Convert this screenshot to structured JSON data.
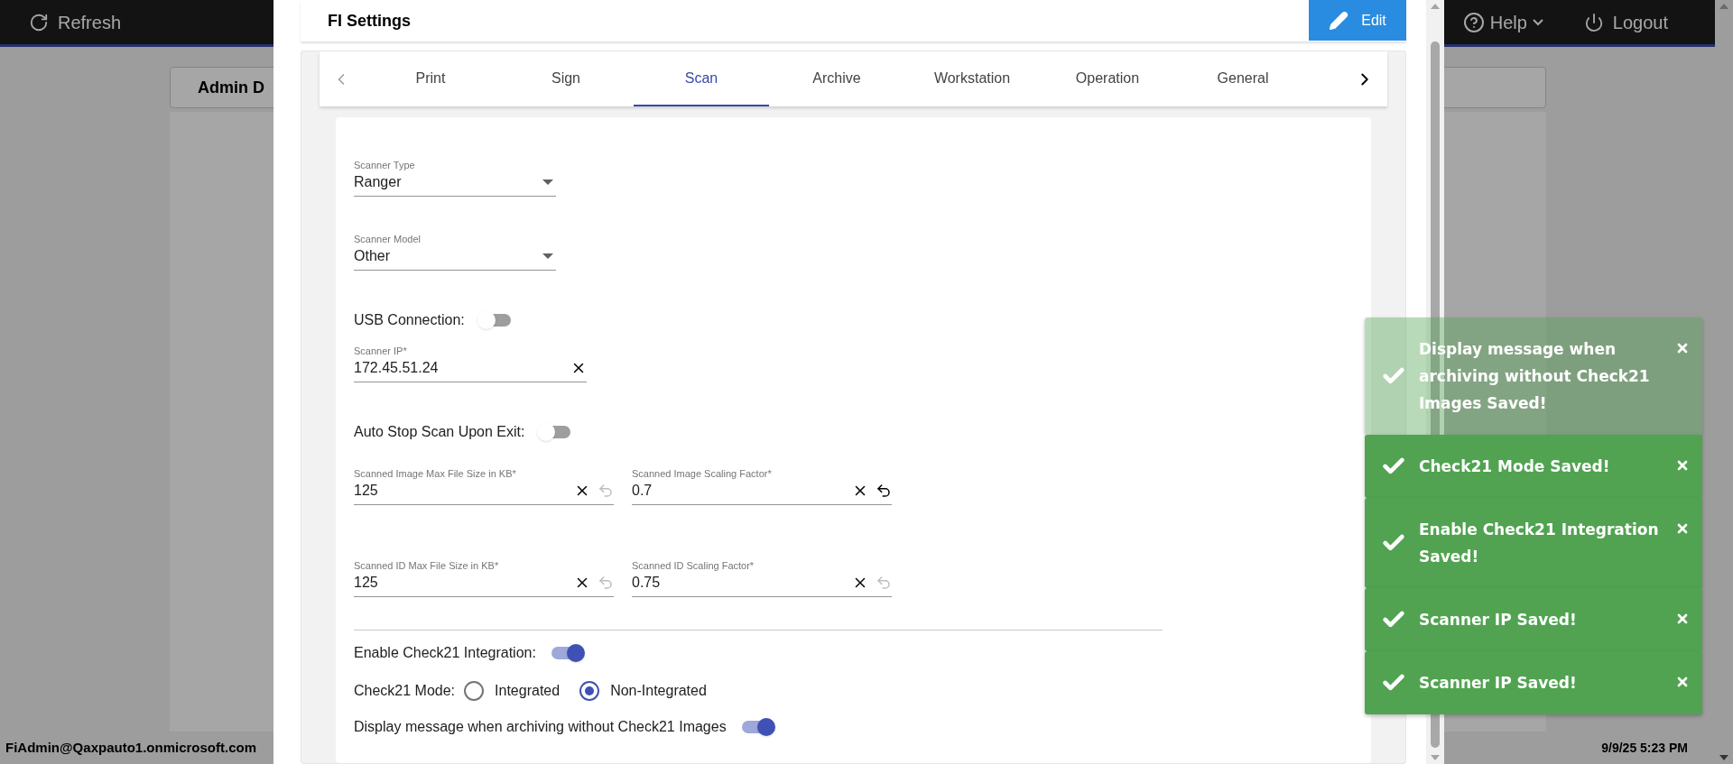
{
  "top_bar": {
    "refresh": "Refresh",
    "help": "Help",
    "logout": "Logout"
  },
  "background": {
    "card_title": "Admin D",
    "user": "FiAdmin@Qaxpauto1.onmicrosoft.com",
    "datetime": "9/9/25 5:23 PM"
  },
  "dialog": {
    "title": "FI Settings",
    "edit_button": "Edit",
    "tabs": [
      {
        "label": "Print",
        "selected": false
      },
      {
        "label": "Sign",
        "selected": false
      },
      {
        "label": "Scan",
        "selected": true
      },
      {
        "label": "Archive",
        "selected": false
      },
      {
        "label": "Workstation",
        "selected": false
      },
      {
        "label": "Operation",
        "selected": false
      },
      {
        "label": "General",
        "selected": false
      }
    ],
    "form": [
      {
        "kind": "select",
        "label": "Scanner Type",
        "value": "Ranger"
      },
      {
        "kind": "select",
        "label": "Scanner Model",
        "value": "Other"
      },
      {
        "kind": "switch",
        "label": "USB Connection:",
        "on": false
      },
      {
        "kind": "text",
        "label": "Scanner IP*",
        "value": "172.45.51.24"
      },
      {
        "kind": "switch",
        "label": "Auto Stop Scan Upon Exit:",
        "on": false
      },
      {
        "kind": "pair",
        "fields": [
          {
            "label": "Scanned Image Max File Size in KB*",
            "value": "125",
            "undo_enabled": false
          },
          {
            "label": "Scanned Image Scaling Factor*",
            "value": "0.7",
            "undo_enabled": true
          }
        ]
      },
      {
        "kind": "pair",
        "fields": [
          {
            "label": "Scanned ID Max File Size in KB*",
            "value": "125",
            "undo_enabled": false
          },
          {
            "label": "Scanned ID Scaling Factor*",
            "value": "0.75",
            "undo_enabled": false
          }
        ]
      },
      {
        "kind": "divider"
      },
      {
        "kind": "switch",
        "label": "Enable Check21 Integration:",
        "on": true
      },
      {
        "kind": "radio",
        "label": "Check21 Mode:",
        "options": [
          {
            "label": "Integrated",
            "selected": false
          },
          {
            "label": "Non-Integrated",
            "selected": true
          }
        ]
      },
      {
        "kind": "switch",
        "label": "Display message when archiving without Check21 Images",
        "on": true
      }
    ]
  },
  "toasts": [
    {
      "message": "Display message when archiving without Check21 Images Saved!",
      "fading": true
    },
    {
      "message": "Check21 Mode Saved!",
      "fading": false
    },
    {
      "message": "Enable Check21 Integration Saved!",
      "fading": false
    },
    {
      "message": "Scanner IP Saved!",
      "fading": false
    },
    {
      "message": "Scanner IP Saved!",
      "fading": false
    }
  ]
}
